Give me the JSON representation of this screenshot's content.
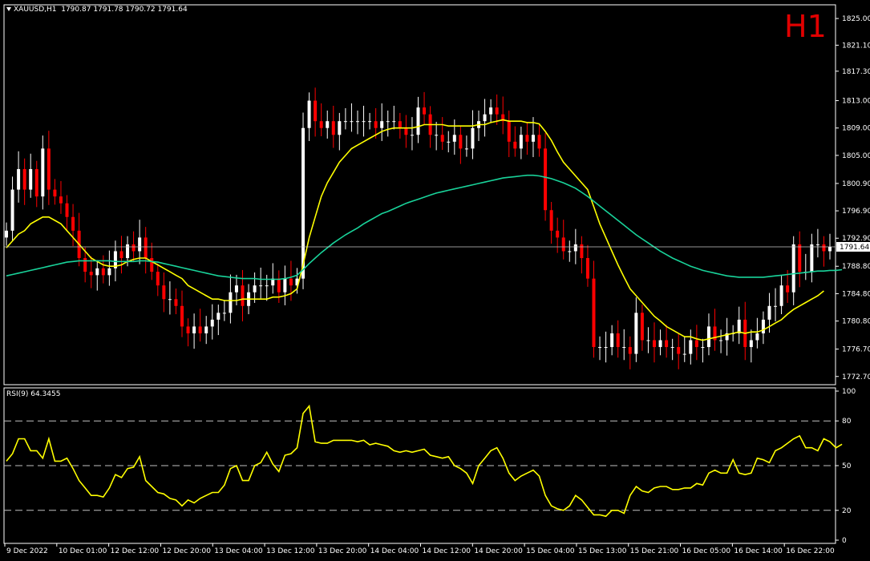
{
  "header": {
    "symbol": "XAUUSD,H1",
    "ohlc": "1790.87 1791.78 1790.72 1791.64",
    "timeframe_badge": "H1"
  },
  "rsi_header": {
    "label": "RSI(9) 64.3455"
  },
  "colors": {
    "background": "#000000",
    "frame": "#ffffff",
    "bull_candle": "#ffffff",
    "bear_candle": "#ff0000",
    "fast_ma": "#ffff00",
    "slow_ma": "#19d39a",
    "rsi_line": "#ffff00",
    "badge": "#e00000"
  },
  "chart_data": [
    {
      "type": "candlestick",
      "symbol": "XAUUSD",
      "timeframe": "H1",
      "current_price": "1791.64",
      "ylim": [
        1771.5,
        1827
      ],
      "yticks": [
        "1825.00",
        "1821.10",
        "1817.30",
        "1813.00",
        "1809.00",
        "1805.00",
        "1800.90",
        "1796.90",
        "1792.90",
        "1788.80",
        "1784.80",
        "1780.80",
        "1776.70",
        "1772.70"
      ],
      "x_labels": [
        "9 Dec 2022",
        "10 Dec 01:00",
        "12 Dec 12:00",
        "12 Dec 20:00",
        "13 Dec 04:00",
        "13 Dec 12:00",
        "13 Dec 20:00",
        "14 Dec 04:00",
        "14 Dec 12:00",
        "14 Dec 20:00",
        "15 Dec 04:00",
        "15 Dec 13:00",
        "15 Dec 21:00",
        "16 Dec 05:00",
        "16 Dec 14:00",
        "16 Dec 22:00"
      ],
      "close": [
        1794,
        1800,
        1803,
        1800,
        1803,
        1799,
        1806,
        1800,
        1799,
        1798,
        1796,
        1794,
        1790,
        1788,
        1787.5,
        1788.5,
        1787.5,
        1788.5,
        1791,
        1790,
        1792,
        1791,
        1793,
        1790,
        1788,
        1786,
        1784,
        1784,
        1783,
        1780,
        1779,
        1780,
        1779,
        1780,
        1781,
        1782,
        1782,
        1785,
        1786,
        1783,
        1785,
        1786,
        1786,
        1786,
        1787,
        1785,
        1787,
        1786,
        1787,
        1809,
        1813,
        1810,
        1809,
        1810,
        1808,
        1810,
        1810,
        1810,
        1810,
        1810,
        1810,
        1809,
        1810,
        1810,
        1810,
        1809,
        1808,
        1808,
        1812,
        1811,
        1808,
        1808,
        1807,
        1807,
        1808,
        1806,
        1806,
        1809,
        1810,
        1811,
        1812,
        1811,
        1810,
        1807,
        1806,
        1808,
        1807,
        1808,
        1806,
        1797,
        1794,
        1793,
        1791,
        1791,
        1792,
        1790,
        1787,
        1777,
        1777,
        1777,
        1779,
        1777,
        1777,
        1776,
        1782,
        1778,
        1778,
        1777,
        1778,
        1777,
        1777,
        1776,
        1776,
        1778,
        1777,
        1777,
        1780,
        1778,
        1778,
        1779,
        1779,
        1781,
        1777,
        1778,
        1779,
        1781,
        1783,
        1783,
        1786,
        1785,
        1792,
        1788,
        1788,
        1792,
        1792,
        1791,
        1791.64
      ],
      "series": [
        {
          "name": "fast MA",
          "values": [
            1791.5,
            1792.5,
            1793.5,
            1794,
            1795,
            1795.5,
            1796,
            1796,
            1795.5,
            1795,
            1794,
            1793,
            1792,
            1791,
            1790,
            1789.5,
            1789,
            1788.8,
            1788.8,
            1789,
            1789.5,
            1789.8,
            1790,
            1790,
            1789.5,
            1789,
            1788.5,
            1788,
            1787.5,
            1787,
            1786,
            1785.5,
            1785,
            1784.5,
            1784,
            1784,
            1783.8,
            1783.8,
            1783.8,
            1784,
            1784,
            1784,
            1784,
            1784,
            1784.3,
            1784.3,
            1784.5,
            1784.8,
            1785.5,
            1789,
            1793,
            1796,
            1799,
            1801,
            1802.5,
            1804,
            1805,
            1806,
            1806.5,
            1807,
            1807.5,
            1808,
            1808.5,
            1808.8,
            1809,
            1809,
            1809,
            1809,
            1809.2,
            1809.5,
            1809.5,
            1809.5,
            1809.5,
            1809.3,
            1809.3,
            1809.3,
            1809.3,
            1809.3,
            1809.5,
            1809.5,
            1809.8,
            1810,
            1810.2,
            1810,
            1810,
            1810,
            1809.8,
            1809.8,
            1809.6,
            1808.5,
            1807.2,
            1805.5,
            1804,
            1803,
            1802,
            1801,
            1800,
            1797.5,
            1795,
            1793,
            1791,
            1789,
            1787.2,
            1785.5,
            1784.5,
            1783.5,
            1782.5,
            1781.5,
            1780.8,
            1780,
            1779.5,
            1779,
            1778.5,
            1778.5,
            1778.2,
            1778,
            1778.2,
            1778.4,
            1778.6,
            1778.8,
            1779,
            1779.2,
            1779,
            1779.2,
            1779.2,
            1779.5,
            1780,
            1780.5,
            1781,
            1781.8,
            1782.5,
            1783,
            1783.5,
            1784,
            1784.5,
            1785.2
          ]
        },
        {
          "name": "slow MA",
          "values": [
            1787.4,
            1787.6,
            1787.8,
            1788,
            1788.2,
            1788.4,
            1788.6,
            1788.8,
            1789,
            1789.2,
            1789.4,
            1789.5,
            1789.6,
            1789.6,
            1789.6,
            1789.6,
            1789.6,
            1789.6,
            1789.5,
            1789.5,
            1789.5,
            1789.5,
            1789.6,
            1789.6,
            1789.5,
            1789.4,
            1789.2,
            1789,
            1788.8,
            1788.6,
            1788.4,
            1788.2,
            1788,
            1787.8,
            1787.6,
            1787.4,
            1787.3,
            1787.2,
            1787.1,
            1787,
            1787,
            1787,
            1786.9,
            1786.9,
            1786.9,
            1786.9,
            1787,
            1787.2,
            1787.5,
            1788.3,
            1789.2,
            1790,
            1790.8,
            1791.5,
            1792.2,
            1792.8,
            1793.4,
            1793.9,
            1794.4,
            1795,
            1795.5,
            1796,
            1796.5,
            1796.8,
            1797.2,
            1797.6,
            1798,
            1798.3,
            1798.6,
            1798.9,
            1799.2,
            1799.5,
            1799.7,
            1799.9,
            1800.1,
            1800.3,
            1800.5,
            1800.7,
            1800.9,
            1801.1,
            1801.3,
            1801.5,
            1801.7,
            1801.8,
            1801.9,
            1802,
            1802.1,
            1802.1,
            1802,
            1801.8,
            1801.6,
            1801.3,
            1801,
            1800.6,
            1800.2,
            1799.6,
            1799,
            1798.3,
            1797.6,
            1796.9,
            1796.2,
            1795.5,
            1794.8,
            1794.1,
            1793.4,
            1792.8,
            1792.2,
            1791.6,
            1791,
            1790.5,
            1790,
            1789.6,
            1789.2,
            1788.8,
            1788.5,
            1788.2,
            1788,
            1787.8,
            1787.6,
            1787.4,
            1787.3,
            1787.2,
            1787.2,
            1787.2,
            1787.2,
            1787.2,
            1787.3,
            1787.4,
            1787.5,
            1787.6,
            1787.7,
            1787.8,
            1787.9,
            1788,
            1788.1,
            1788.1,
            1788.2,
            1788.2,
            1788.3
          ]
        }
      ]
    },
    {
      "type": "line",
      "ylim": [
        0,
        100
      ],
      "yticks": [
        "100",
        "80",
        "50",
        "20",
        "0"
      ],
      "series": [
        {
          "name": "RSI(9)",
          "values": [
            53,
            58,
            68,
            68,
            60,
            60,
            55,
            68,
            53,
            53,
            55,
            48,
            40,
            35,
            30,
            30,
            29,
            35,
            44,
            42,
            48,
            49,
            56,
            40,
            36,
            32,
            31,
            28,
            27,
            23,
            27,
            25,
            28,
            30,
            32,
            32,
            37,
            48,
            50,
            40,
            40,
            50,
            52,
            59,
            51,
            46,
            57,
            58,
            62,
            85,
            90,
            66,
            65,
            65,
            67,
            67,
            67,
            67,
            66,
            67,
            64,
            65,
            64,
            63,
            60,
            59,
            60,
            59,
            60,
            61,
            57,
            56,
            55,
            56,
            50,
            48,
            45,
            38,
            50,
            55,
            60,
            62,
            55,
            45,
            40,
            43,
            45,
            47,
            43,
            30,
            23,
            21,
            20,
            23,
            30,
            27,
            22,
            17,
            17,
            16,
            20,
            20,
            18,
            30,
            36,
            33,
            32,
            35,
            36,
            36,
            34,
            34,
            35,
            35,
            38,
            37,
            45,
            47,
            45,
            45,
            54,
            45,
            44,
            45,
            55,
            54,
            52,
            60,
            62,
            65,
            68,
            70,
            62,
            62,
            60,
            68,
            66,
            62,
            64.35
          ]
        }
      ]
    }
  ]
}
